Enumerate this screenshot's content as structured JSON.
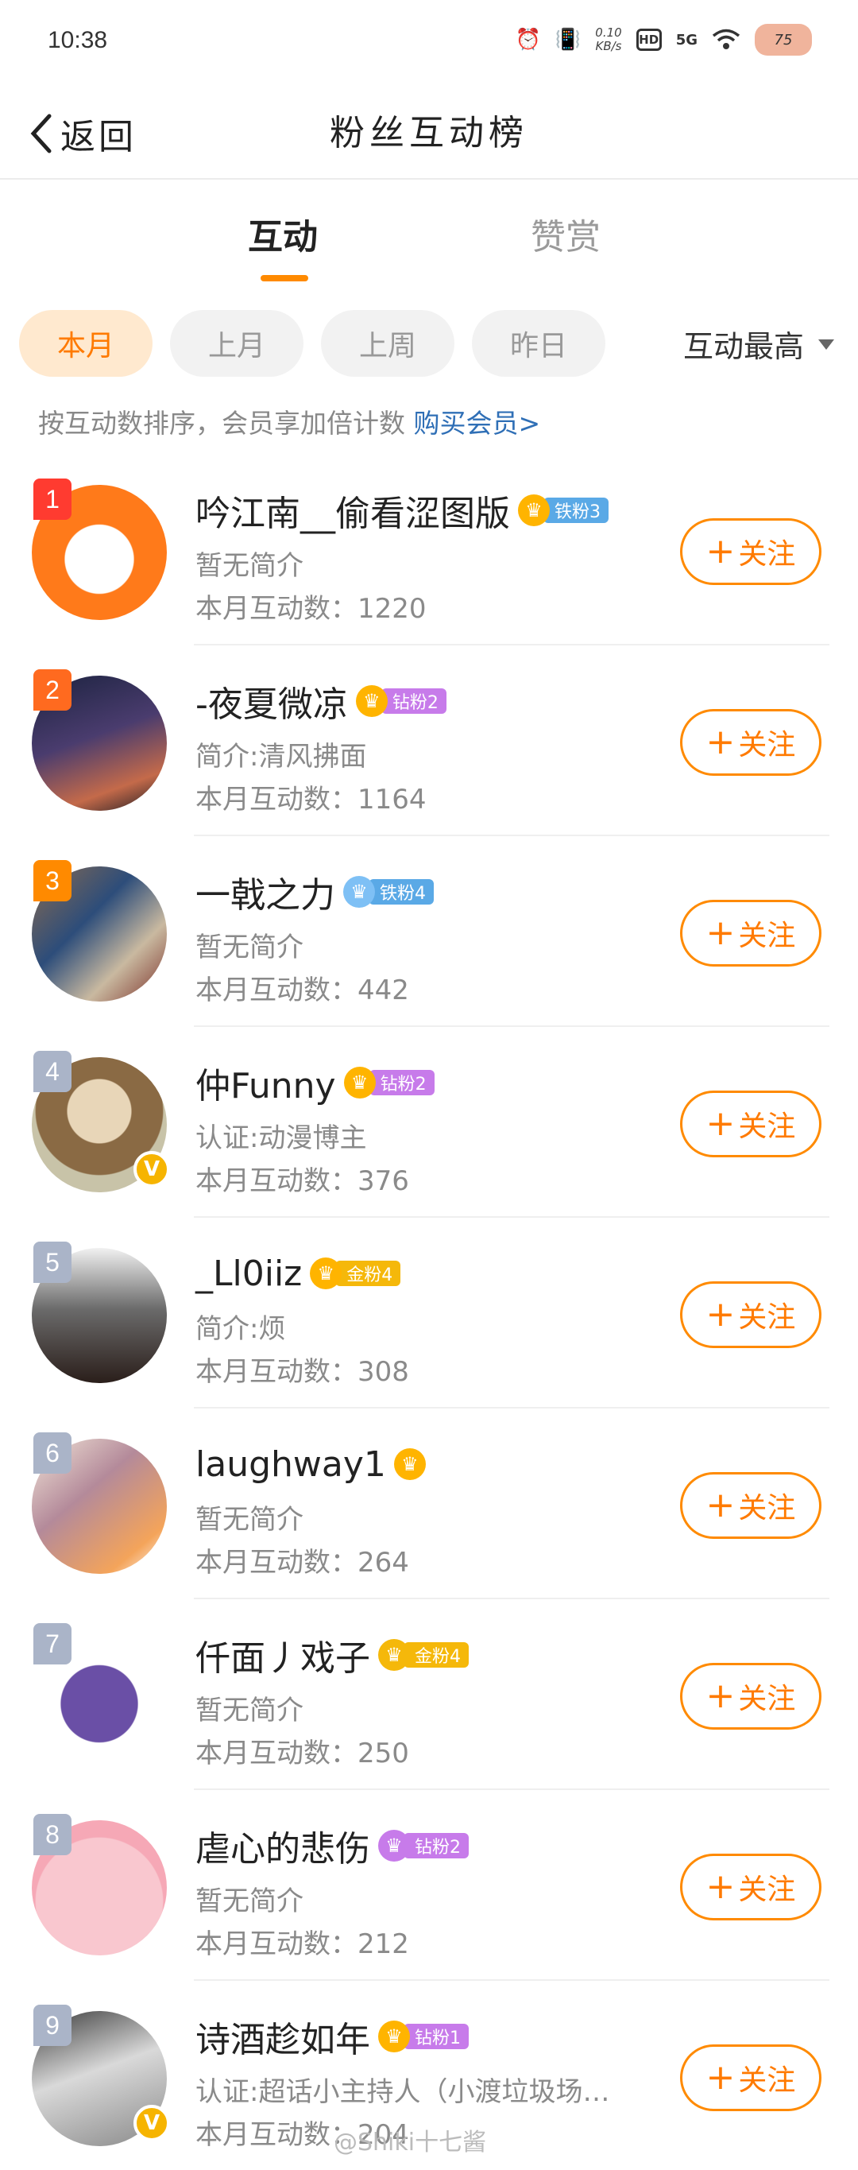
{
  "status": {
    "time": "10:38",
    "speed_value": "0.10",
    "speed_unit": "KB/s",
    "hd": "HD",
    "network": "5G",
    "battery": "75"
  },
  "nav": {
    "back_label": "返回",
    "title": "粉丝互动榜"
  },
  "tabs": [
    {
      "label": "互动"
    },
    {
      "label": "赞赏"
    }
  ],
  "filters": {
    "chips": [
      {
        "label": "本月"
      },
      {
        "label": "上月"
      },
      {
        "label": "上周"
      },
      {
        "label": "昨日"
      }
    ],
    "sort_label": "互动最高"
  },
  "hint": {
    "text": "按互动数排序，会员享加倍计数",
    "link": "购买会员>"
  },
  "follow_label": "关注",
  "users": [
    {
      "rank": "1",
      "name": "吟江南__偷看涩图版",
      "badge_icon": "3",
      "badge_label": "铁粉3",
      "badge_color": "#5aa9e6",
      "icon_color": "#ffb400",
      "desc": "暂无简介",
      "count": "本月互动数：1220",
      "verified": false
    },
    {
      "rank": "2",
      "name": "-夜夏微凉",
      "badge_icon": "",
      "badge_label": "钻粉2",
      "badge_color": "#c77bea",
      "icon_color": "#ffb400",
      "desc": "简介:清风拂面",
      "count": "本月互动数：1164",
      "verified": false
    },
    {
      "rank": "3",
      "name": "一戟之力",
      "badge_icon": "",
      "badge_label": "铁粉4",
      "badge_color": "#5aa9e6",
      "icon_color": "#7ec0f5",
      "desc": "暂无简介",
      "count": "本月互动数：442",
      "verified": false
    },
    {
      "rank": "4",
      "name": "仲Funny",
      "badge_icon": "",
      "badge_label": "钻粉2",
      "badge_color": "#c77bea",
      "icon_color": "#ffb400",
      "desc": "认证:动漫博主",
      "count": "本月互动数：376",
      "verified": true
    },
    {
      "rank": "5",
      "name": "_Ll0iiz",
      "badge_icon": "6",
      "badge_label": "金粉4",
      "badge_color": "#f5b80a",
      "icon_color": "#ffb400",
      "desc": "简介:烦",
      "count": "本月互动数：308",
      "verified": false
    },
    {
      "rank": "6",
      "name": "laughway1",
      "badge_icon": "",
      "badge_label": "",
      "badge_color": "#f5b80a",
      "icon_color": "#ffb400",
      "desc": "暂无简介",
      "count": "本月互动数：264",
      "verified": false
    },
    {
      "rank": "7",
      "name": "仟面丿戏子",
      "badge_icon": "",
      "badge_label": "金粉4",
      "badge_color": "#f5b80a",
      "icon_color": "#f5b80a",
      "desc": "暂无简介",
      "count": "本月互动数：250",
      "verified": false
    },
    {
      "rank": "8",
      "name": "虐心的悲伤",
      "badge_icon": "",
      "badge_label": "钻粉2",
      "badge_color": "#c77bea",
      "icon_color": "#c77bea",
      "desc": "暂无简介",
      "count": "本月互动数：212",
      "verified": false
    },
    {
      "rank": "9",
      "name": "诗酒趁如年",
      "badge_icon": "",
      "badge_label": "钻粉1",
      "badge_color": "#c77bea",
      "icon_color": "#ffb400",
      "desc": "认证:超话小主持人（小渡垃圾场…",
      "count": "本月互动数：204",
      "verified": true
    }
  ],
  "watermark": "@Shiki十七酱",
  "colors": {
    "accent": "#ff8a00",
    "rank_top": "#ff3b30",
    "rank_2": "#ff6a1f",
    "rank_3": "#ff8a00",
    "rank_other": "#aab4c8"
  }
}
